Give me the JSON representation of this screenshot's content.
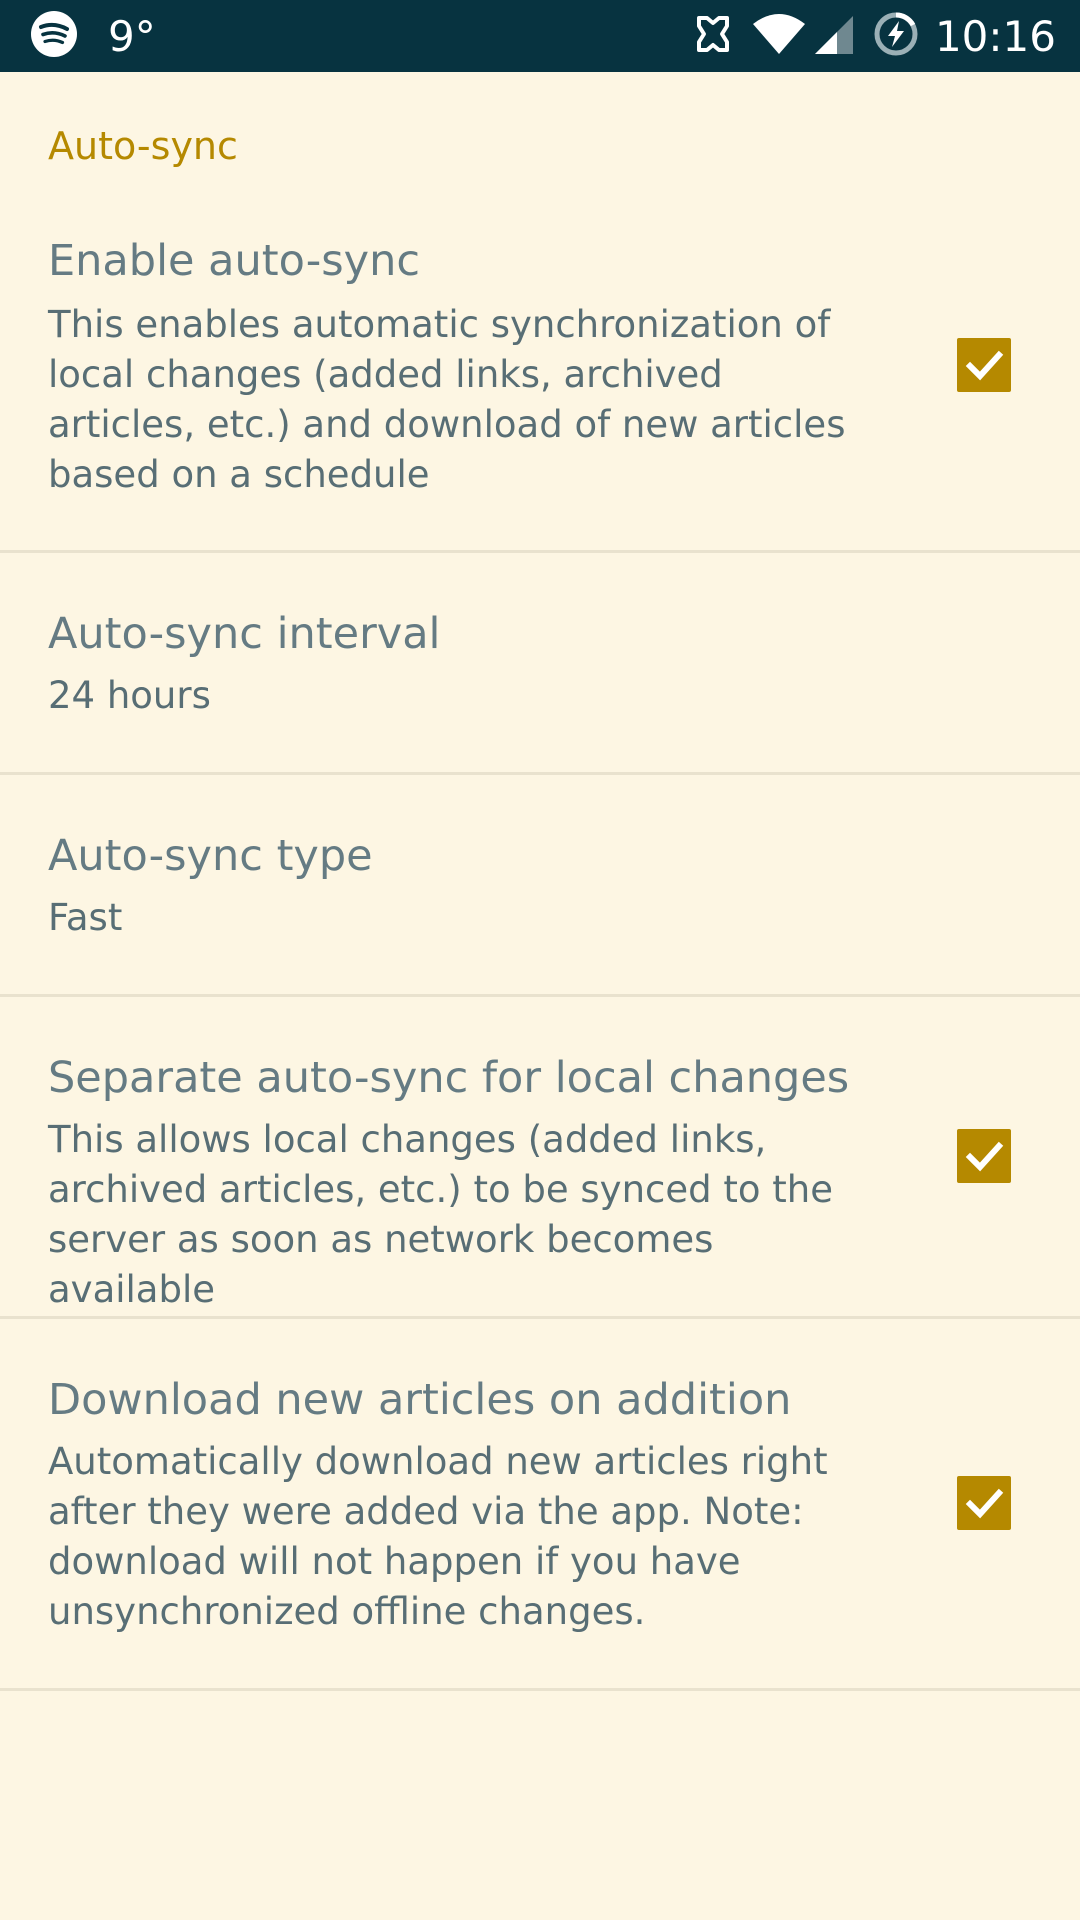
{
  "status_bar": {
    "temperature": "9°",
    "time": "10:16",
    "icons": [
      "spotify-icon",
      "nfc-icon",
      "wifi-icon",
      "cellular-signal-icon",
      "battery-charging-icon"
    ]
  },
  "settings": {
    "section_title": "Auto-sync",
    "items": [
      {
        "title": "Enable auto-sync",
        "summary": "This enables automatic synchronization of local changes (added links, archived articles, etc.) and download of new articles based on a schedule",
        "checked": true
      },
      {
        "title": "Auto-sync interval",
        "summary": "24 hours"
      },
      {
        "title": "Auto-sync type",
        "summary": "Fast"
      },
      {
        "title": "Separate auto-sync for local changes",
        "summary": "This allows local changes (added links, archived articles, etc.) to be synced to the server as soon as network becomes available",
        "checked": true
      },
      {
        "title": "Download new articles on addition",
        "summary": "Automatically download new articles right after they were added via the app. Note: download will not happen if you have unsynchronized offline changes.",
        "checked": true
      }
    ]
  },
  "colors": {
    "background": "#FDF6E3",
    "accent": "#B58900",
    "status_bar": "#073340",
    "title_text": "#657B83",
    "summary_text": "#586E75",
    "divider": "#E9E2CE"
  }
}
